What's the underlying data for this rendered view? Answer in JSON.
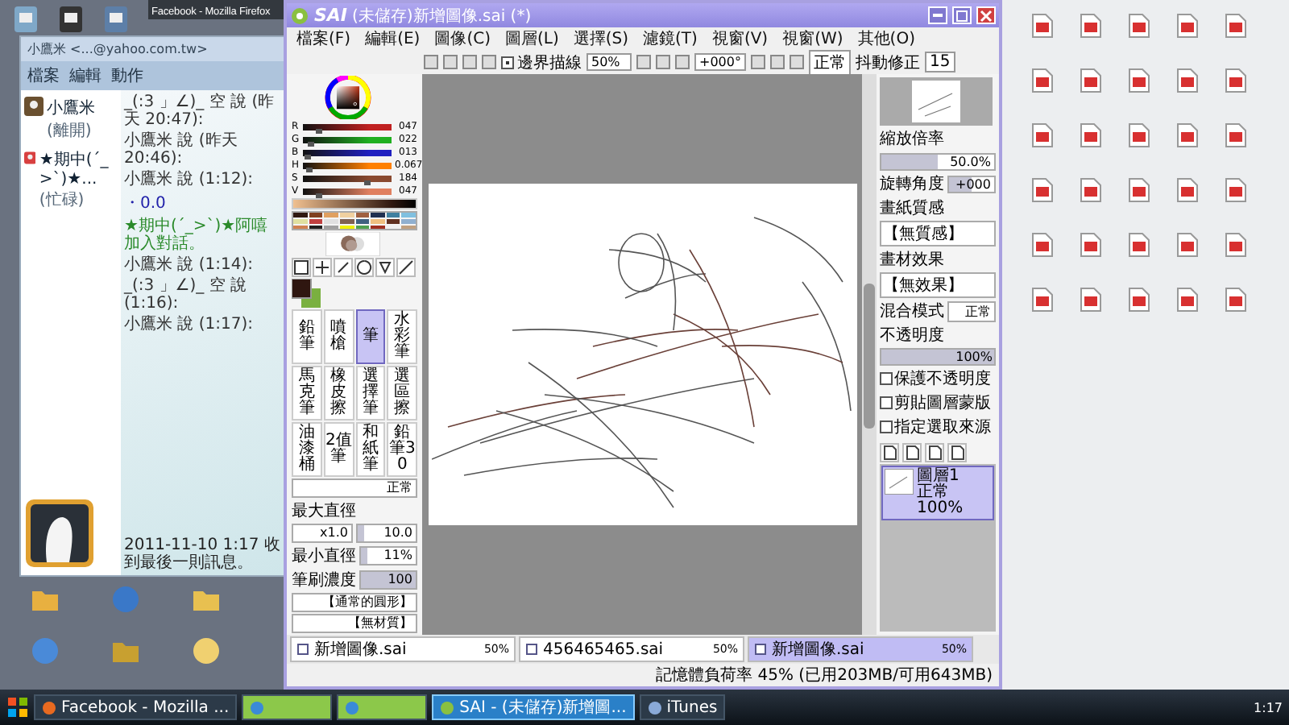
{
  "background_window": {
    "title": "Facebook - Mozilla Firefox"
  },
  "chat": {
    "title": "小鷹米 <...@yahoo.com.tw>",
    "menu": [
      "檔案",
      "編輯",
      "動作"
    ],
    "contacts": [
      {
        "name": "小鷹米",
        "status": "(離開)"
      },
      {
        "name": "★期中(´_>`)★...",
        "status": "(忙碌)"
      }
    ],
    "messages": [
      {
        "kind": "sender",
        "text": "_(:3 」∠)_ 空 說 (昨天 20:47):"
      },
      {
        "kind": "sender",
        "text": "小鷹米 說 (昨天 20:46):"
      },
      {
        "kind": "sender",
        "text": "小鷹米 說 (1:12):"
      },
      {
        "kind": "body",
        "text": "・0.0"
      },
      {
        "kind": "notice",
        "text": "★期中(´_>`)★阿嘻加入對話。"
      },
      {
        "kind": "sender",
        "text": "小鷹米 說 (1:14):"
      },
      {
        "kind": "sender",
        "text": "_(:3 」∠)_ 空 說 (1:16):"
      },
      {
        "kind": "sender",
        "text": "小鷹米 說 (1:17):"
      }
    ],
    "last_received": "2011-11-10 1:17 收到最後一則訊息。"
  },
  "sai": {
    "logo": "SAI",
    "title": "(未儲存)新增圖像.sai (*)",
    "menu": [
      "檔案(F)",
      "編輯(E)",
      "圖像(C)",
      "圖層(L)",
      "選擇(S)",
      "濾鏡(T)",
      "視窗(V)",
      "視窗(W)",
      "其他(O)"
    ],
    "toolbar": {
      "edge_checkbox": {
        "label": "邊界描線",
        "checked": true
      },
      "zoom": "50%",
      "angle": "+000°",
      "blend": "正常",
      "stabilizer_label": "抖動修正",
      "stabilizer": "15"
    },
    "sliders": [
      {
        "label": "R",
        "level": 0.18,
        "reading": "047",
        "color": "#c02020"
      },
      {
        "label": "G",
        "level": 0.09,
        "reading": "022",
        "color": "#20b020"
      },
      {
        "label": "B",
        "level": 0.05,
        "reading": "013",
        "color": "#2020c0"
      },
      {
        "label": "H",
        "level": 0.067,
        "reading": "0.067",
        "color": "#ff8000"
      },
      {
        "label": "S",
        "level": 0.72,
        "reading": "184",
        "color": "#8a4a30"
      },
      {
        "label": "V",
        "level": 0.18,
        "reading": "047",
        "color": "#e08060"
      }
    ],
    "brushes": [
      {
        "name": "鉛筆",
        "selected": false
      },
      {
        "name": "噴槍",
        "selected": false
      },
      {
        "name": "筆",
        "selected": true
      },
      {
        "name": "水彩筆",
        "selected": false
      },
      {
        "name": "馬克筆",
        "selected": false
      },
      {
        "name": "橡皮擦",
        "selected": false
      },
      {
        "name": "選擇筆",
        "selected": false
      },
      {
        "name": "選區擦",
        "selected": false
      },
      {
        "name": "油漆桶",
        "selected": false
      },
      {
        "name": "2值筆",
        "selected": false
      },
      {
        "name": "和紙筆",
        "selected": false
      },
      {
        "name": "鉛筆30",
        "selected": false
      }
    ],
    "brush_settings": {
      "mode": "正常",
      "max_label": "最大直徑",
      "max_mult": "x1.0",
      "max_slider": {
        "value": "10.0",
        "level": 0.1
      },
      "min_label": "最小直徑",
      "min_slider": {
        "value": "11%",
        "level": 0.11
      },
      "density_label": "筆刷濃度",
      "density_slider": {
        "value": "100",
        "level": 1
      },
      "shape": "【通常的圓形】",
      "texture": "【無材質】"
    },
    "navigator": {
      "zoom_label": "縮放倍率",
      "zoom_slider": {
        "value": "50.0%",
        "level": 0.5
      },
      "angle_label": "旋轉角度",
      "angle_slider": {
        "value": "+000",
        "level": 0.5
      }
    },
    "layer_props": {
      "paper_label": "畫紙質感",
      "paper": "【無質感】",
      "effect_label": "畫材效果",
      "effect": "【無效果】",
      "blend_label": "混合模式",
      "blend": "正常",
      "opacity_label": "不透明度",
      "opacity_slider": {
        "value": "100%",
        "level": 1
      },
      "options": [
        {
          "label": "保護不透明度",
          "checked": false
        },
        {
          "label": "剪貼圖層蒙版",
          "checked": false
        },
        {
          "label": "指定選取來源",
          "checked": false
        }
      ]
    },
    "layers": [
      {
        "name": "圖層1",
        "mode": "正常",
        "opacity": "100%",
        "selected": true
      }
    ],
    "doc_tabs": [
      {
        "name": "新增圖像.sai",
        "zoom": "50%",
        "selected": false
      },
      {
        "name": "456465465.sai",
        "zoom": "50%",
        "selected": false
      },
      {
        "name": "新增圖像.sai",
        "zoom": "50%",
        "selected": true
      }
    ],
    "status": "記憶體負荷率 45% (已用203MB/可用643MB)"
  },
  "taskbar": {
    "items": [
      {
        "kind": "firefox",
        "label": "Facebook - Mozilla ...",
        "selected": false
      },
      {
        "kind": "messenger",
        "selected": false
      },
      {
        "kind": "messenger",
        "selected": false
      },
      {
        "kind": "sai",
        "label": "SAI - (未儲存)新增圖...",
        "selected": true
      },
      {
        "kind": "itunes",
        "label": "iTunes",
        "selected": false
      }
    ],
    "clock": "1:17"
  }
}
